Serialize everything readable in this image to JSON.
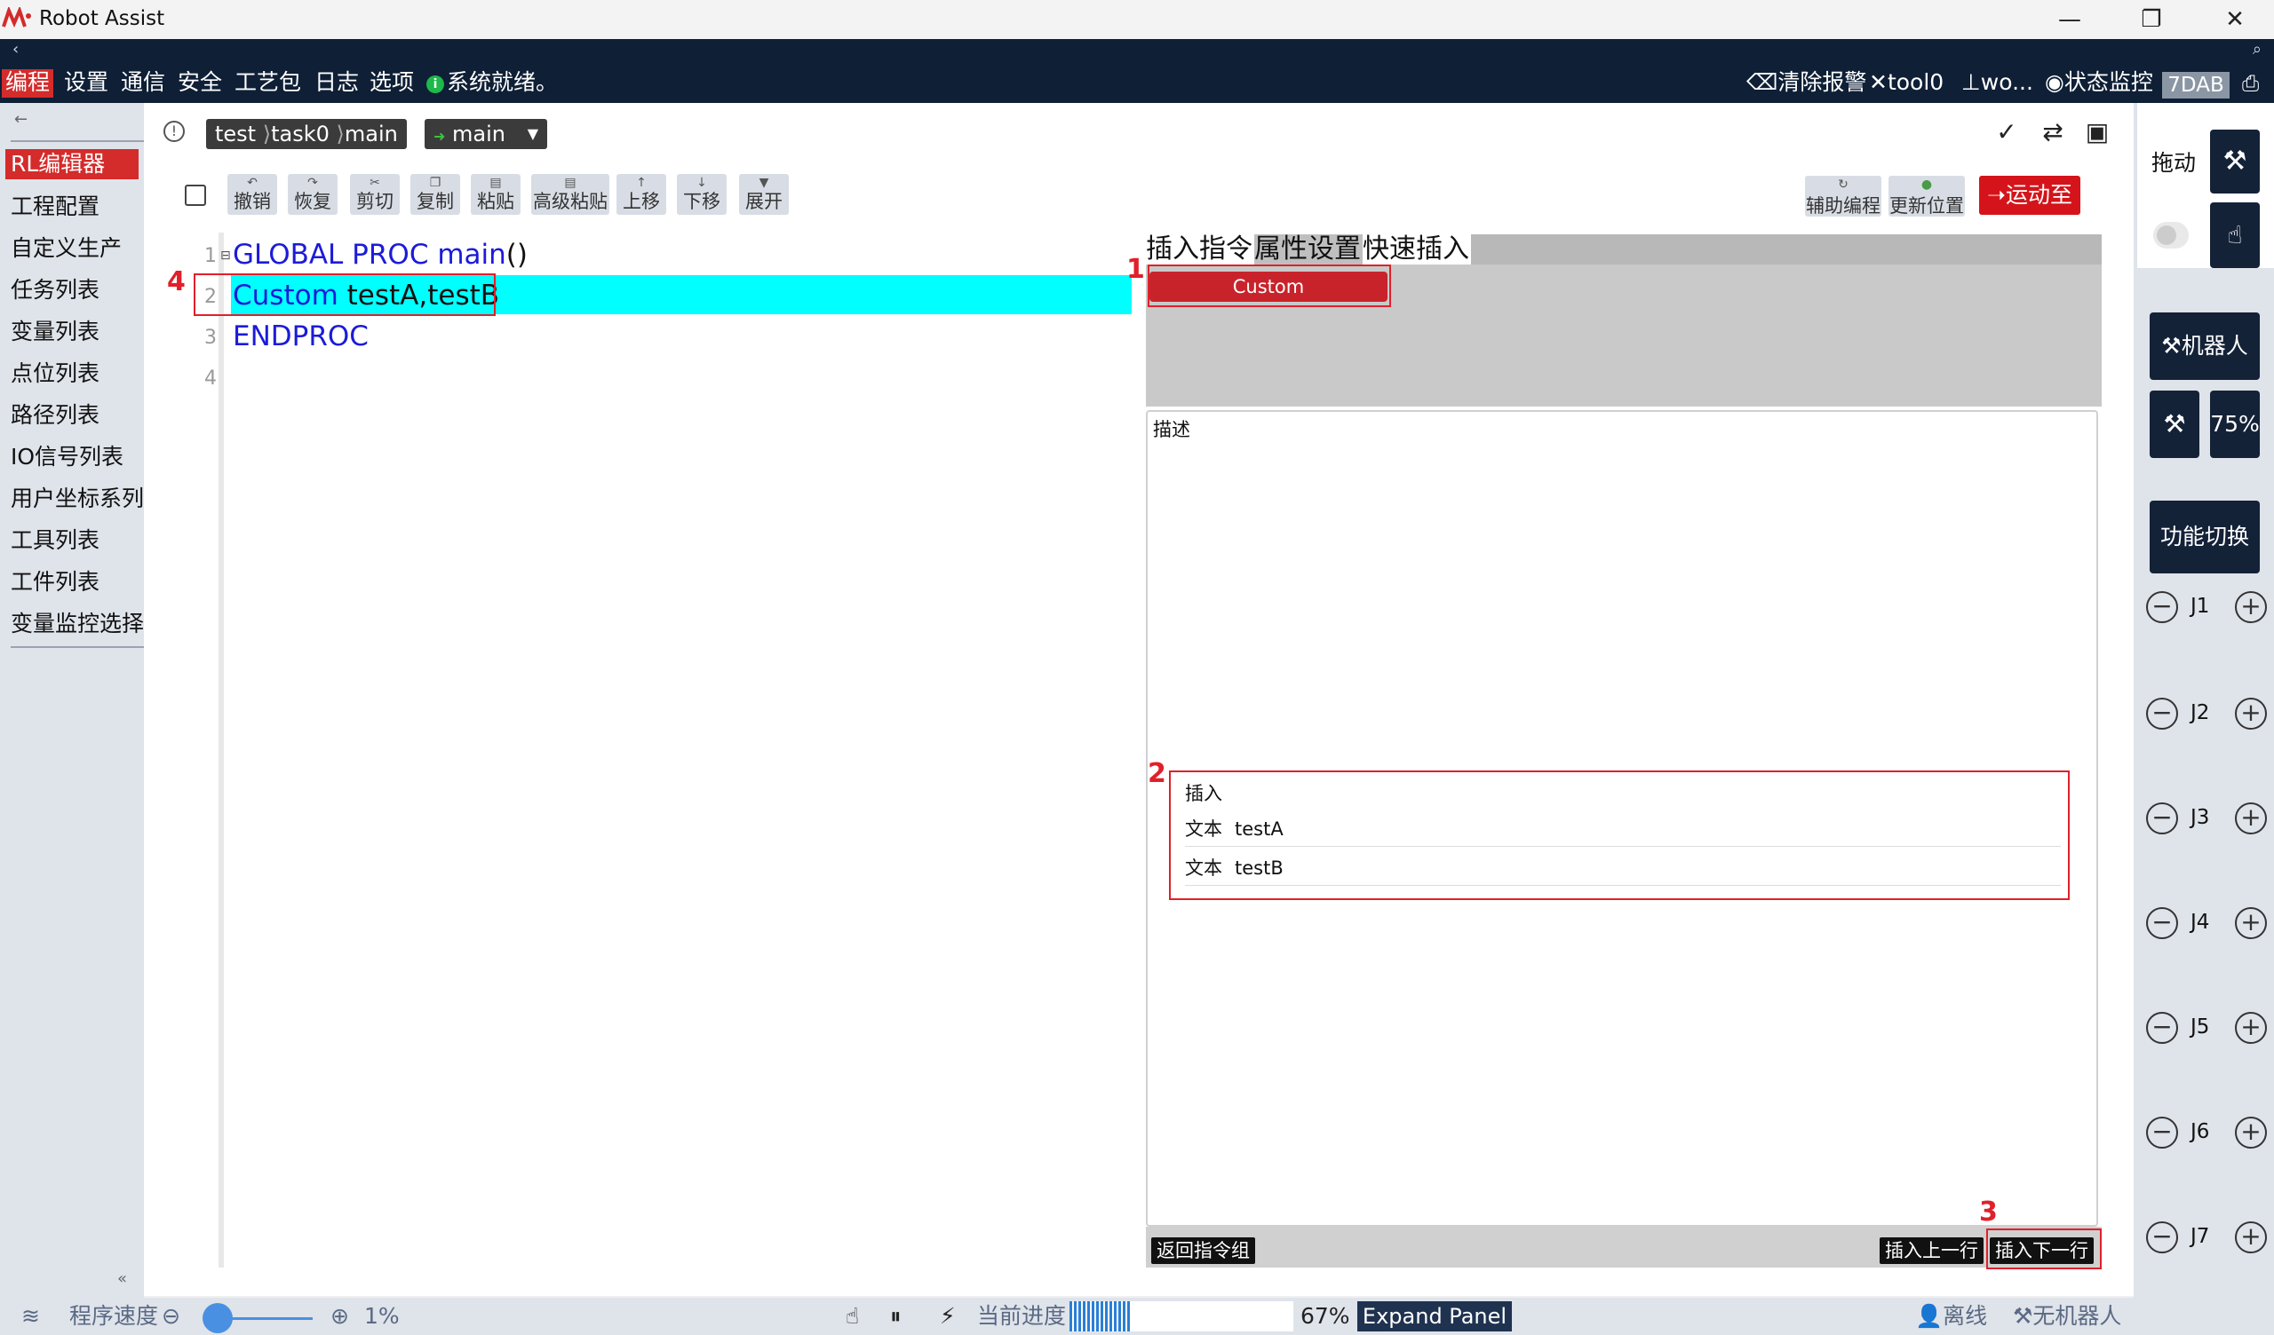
{
  "app": {
    "title": "Robot Assist"
  },
  "navbar": {
    "back": "‹",
    "search": "⌕"
  },
  "menu": {
    "items": [
      "编程",
      "设置",
      "通信",
      "安全",
      "工艺包",
      "日志",
      "选项"
    ],
    "status": "系统就绪。",
    "right": {
      "clear_alarm": "清除报警",
      "tool": "tool0",
      "wobj": "wo...",
      "monitor": "状态监控",
      "device": "7DAB"
    }
  },
  "sidebar": {
    "items": [
      "RL编辑器",
      "工程配置",
      "自定义生产",
      "任务列表",
      "变量列表",
      "点位列表",
      "路径列表",
      "IO信号列表",
      "用户坐标系列",
      "工具列表",
      "工件列表",
      "变量监控选择"
    ]
  },
  "breadcrumb": {
    "project": "test",
    "task": "task0",
    "module": "main",
    "proc": "main"
  },
  "toolbar": {
    "buttons": [
      {
        "icon": "↶",
        "label": "撤销"
      },
      {
        "icon": "↷",
        "label": "恢复"
      },
      {
        "icon": "✂",
        "label": "剪切"
      },
      {
        "icon": "❐",
        "label": "复制"
      },
      {
        "icon": "▤",
        "label": "粘贴"
      },
      {
        "icon": "▤",
        "label": "高级粘贴"
      },
      {
        "icon": "↑",
        "label": "上移"
      },
      {
        "icon": "↓",
        "label": "下移"
      },
      {
        "icon": "▼",
        "label": "展开"
      }
    ],
    "right": {
      "assist": "辅助编程",
      "update_pos": "更新位置",
      "move_to": "运动至"
    }
  },
  "editor": {
    "lines": [
      {
        "num": "1",
        "kw": "GLOBAL PROC main",
        "rest": "()"
      },
      {
        "num": "2",
        "kw": "Custom",
        "rest": " testA,testB"
      },
      {
        "num": "3",
        "kw": "ENDPROC",
        "rest": ""
      },
      {
        "num": "4",
        "kw": "",
        "rest": ""
      }
    ]
  },
  "panel": {
    "tabs": [
      "插入指令",
      "属性设置",
      "快速插入"
    ],
    "custom_btn": "Custom",
    "desc_label": "描述",
    "insert": {
      "title": "插入",
      "rows": [
        {
          "k": "文本",
          "v": "testA"
        },
        {
          "k": "文本",
          "v": "testB"
        }
      ]
    },
    "back_btn": "返回指令组",
    "insert_above": "插入上一行",
    "insert_below": "插入下一行"
  },
  "annotations": [
    "1",
    "2",
    "3",
    "4"
  ],
  "rail": {
    "drag": "拖动",
    "robot": "机器人",
    "speed": "75%",
    "func_switch": "功能切换",
    "joints": [
      "J1",
      "J2",
      "J3",
      "J4",
      "J5",
      "J6",
      "J7"
    ]
  },
  "statusbar": {
    "speed_label": "程序速度",
    "speed_value": "1%",
    "progress_label": "当前进度",
    "progress_value": "67%",
    "progress_fraction": 0.67,
    "expand": "Expand Panel",
    "offline": "离线",
    "no_robot": "无机器人"
  },
  "colors": {
    "accent_red": "#d42b2b",
    "navy": "#0e1f36",
    "highlight": "#00ffff",
    "keyword": "#1b1bd9"
  }
}
